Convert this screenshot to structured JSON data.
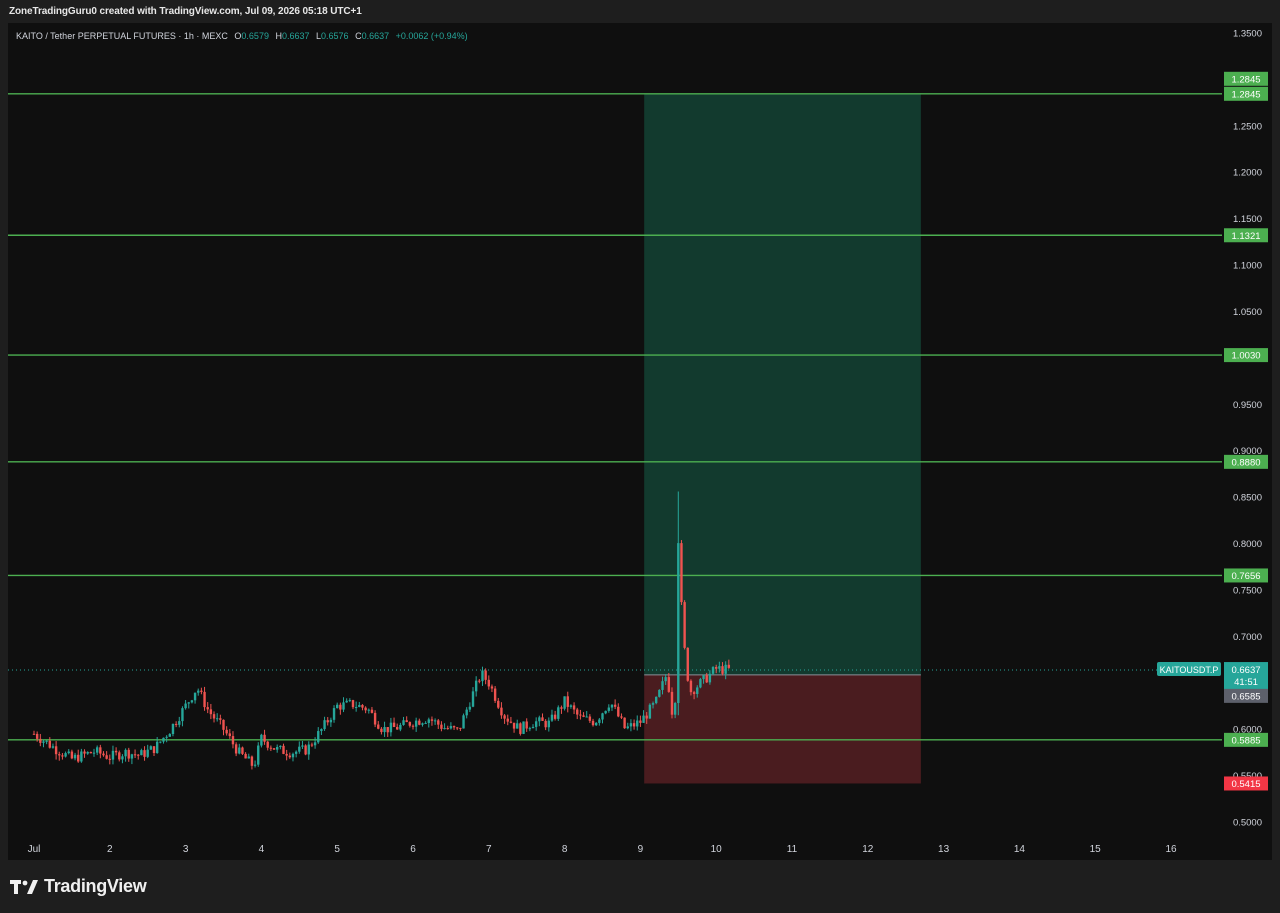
{
  "header": {
    "caption": "ZoneTradingGuru0 created with TradingView.com, Jul 09, 2026 05:18 UTC+1",
    "symbol_line": "KAITO / Tether PERPETUAL FUTURES · 1h · MEXC",
    "ohlc": {
      "o_label": "O",
      "o": "0.6579",
      "h_label": "H",
      "h": "0.6637",
      "l_label": "L",
      "l": "0.6576",
      "c_label": "C",
      "c": "0.6637",
      "change": "+0.0062 (+0.94%)"
    }
  },
  "branding": {
    "logo_text": "TradingView"
  },
  "colors": {
    "background": "#0f0f0f",
    "up": "#26a69a",
    "down": "#ef5350",
    "level_line": "#4caf50",
    "profit_zone": "#123a2e",
    "loss_zone": "#4a1c1f",
    "last_price_tag": "#26a69a",
    "entry_tag": "#5d606b",
    "stop_tag": "#f23645"
  },
  "chart_data": {
    "type": "candlestick",
    "symbol": "KAITOUSDT.P",
    "interval": "1h",
    "y_axis": {
      "min": 0.48,
      "max": 1.36,
      "ticks": [
        "1.3500",
        "1.2500",
        "1.2000",
        "1.1500",
        "1.1000",
        "1.0500",
        "0.9500",
        "0.9000",
        "0.8500",
        "0.8000",
        "0.7500",
        "0.7000",
        "0.6000",
        "0.5500",
        "0.5000"
      ]
    },
    "x_axis": {
      "ticks": [
        "Jul",
        "2",
        "3",
        "4",
        "5",
        "6",
        "7",
        "8",
        "9",
        "10",
        "11",
        "12",
        "13",
        "14",
        "15",
        "16"
      ]
    },
    "horizontal_levels": [
      {
        "price": 1.2845,
        "label": "1.2845"
      },
      {
        "price": 1.1321,
        "label": "1.1321"
      },
      {
        "price": 1.003,
        "label": "1.0030"
      },
      {
        "price": 0.888,
        "label": "0.8880"
      },
      {
        "price": 0.7656,
        "label": "0.7656"
      },
      {
        "price": 0.5885,
        "label": "0.5885"
      }
    ],
    "position": {
      "type": "long",
      "entry": 0.6585,
      "entry_label": "0.6585",
      "target": 1.2845,
      "target_label": "1.2845",
      "stop": 0.5415,
      "stop_label": "0.5415",
      "start_day": 9.05,
      "end_day": 12.7
    },
    "last_price": {
      "value": 0.6637,
      "label": "0.6637",
      "symbol_label": "KAITOUSDT.P",
      "countdown": "41:51"
    },
    "price_path": [
      [
        0.0,
        0.595
      ],
      [
        0.3,
        0.578
      ],
      [
        0.5,
        0.568
      ],
      [
        0.8,
        0.576
      ],
      [
        1.0,
        0.57
      ],
      [
        1.2,
        0.575
      ],
      [
        1.4,
        0.572
      ],
      [
        1.6,
        0.58
      ],
      [
        1.8,
        0.6
      ],
      [
        2.0,
        0.625
      ],
      [
        2.15,
        0.645
      ],
      [
        2.3,
        0.62
      ],
      [
        2.5,
        0.6
      ],
      [
        2.7,
        0.575
      ],
      [
        2.9,
        0.56
      ],
      [
        3.0,
        0.59
      ],
      [
        3.2,
        0.578
      ],
      [
        3.4,
        0.575
      ],
      [
        3.6,
        0.578
      ],
      [
        3.8,
        0.6
      ],
      [
        4.0,
        0.625
      ],
      [
        4.2,
        0.627
      ],
      [
        4.4,
        0.622
      ],
      [
        4.6,
        0.6
      ],
      [
        4.8,
        0.602
      ],
      [
        5.0,
        0.608
      ],
      [
        5.2,
        0.612
      ],
      [
        5.4,
        0.602
      ],
      [
        5.6,
        0.598
      ],
      [
        5.75,
        0.63
      ],
      [
        5.9,
        0.66
      ],
      [
        6.0,
        0.65
      ],
      [
        6.2,
        0.615
      ],
      [
        6.4,
        0.6
      ],
      [
        6.6,
        0.608
      ],
      [
        6.8,
        0.606
      ],
      [
        7.0,
        0.63
      ],
      [
        7.2,
        0.612
      ],
      [
        7.4,
        0.608
      ],
      [
        7.6,
        0.63
      ],
      [
        7.8,
        0.6
      ],
      [
        8.0,
        0.608
      ],
      [
        8.2,
        0.628
      ],
      [
        8.35,
        0.66
      ],
      [
        8.45,
        0.6
      ],
      [
        8.5,
        0.805
      ],
      [
        8.56,
        0.7
      ],
      [
        8.65,
        0.64
      ],
      [
        8.8,
        0.65
      ],
      [
        9.0,
        0.665
      ],
      [
        9.2,
        0.6637
      ]
    ],
    "spike": {
      "day": 8.5,
      "high": 0.856,
      "low": 0.615
    }
  }
}
